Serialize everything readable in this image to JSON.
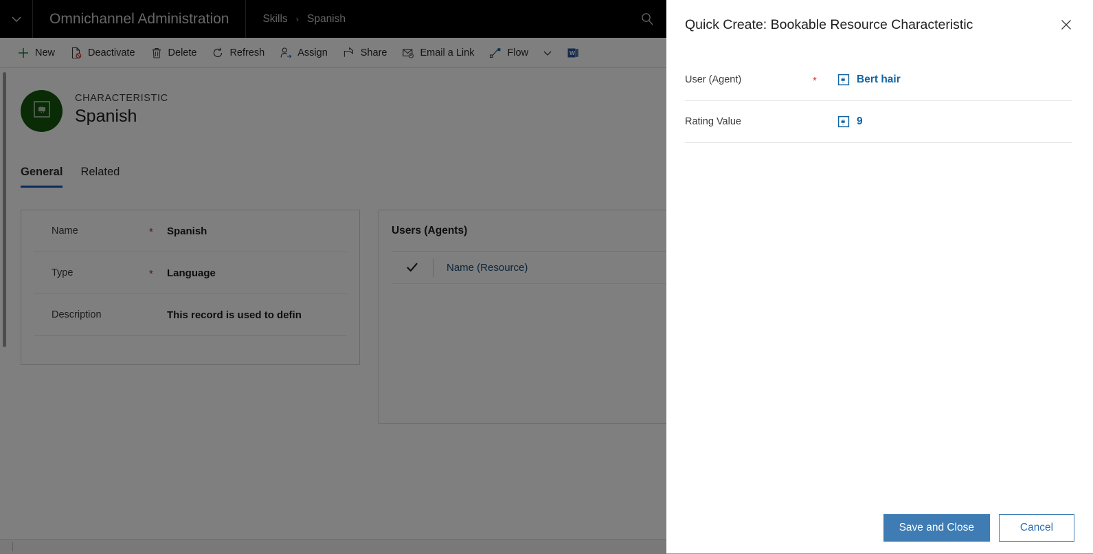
{
  "topbar": {
    "chevron_icon": "chevron-down-icon",
    "app_title": "Omnichannel Administration",
    "breadcrumb": {
      "parent": "Skills",
      "separator": "›",
      "current": "Spanish"
    },
    "search_icon": "search-icon"
  },
  "commandbar": {
    "items": [
      {
        "label": "New",
        "icon": "plus-icon"
      },
      {
        "label": "Deactivate",
        "icon": "deactivate-document-icon"
      },
      {
        "label": "Delete",
        "icon": "trash-icon"
      },
      {
        "label": "Refresh",
        "icon": "refresh-icon"
      },
      {
        "label": "Assign",
        "icon": "assign-user-icon"
      },
      {
        "label": "Share",
        "icon": "share-icon"
      },
      {
        "label": "Email a Link",
        "icon": "email-link-icon"
      },
      {
        "label": "Flow",
        "icon": "flow-icon"
      }
    ],
    "overflow_icon": "chevron-down-icon",
    "word_template_icon": "word-document-icon"
  },
  "record_header": {
    "entity_type": "CHARACTERISTIC",
    "record_name": "Spanish",
    "avatar_icon": "characteristic-puzzle-icon",
    "avatar_color": "#13570d"
  },
  "tabs": [
    {
      "label": "General",
      "active": true
    },
    {
      "label": "Related",
      "active": false
    }
  ],
  "form": {
    "fields": [
      {
        "label": "Name",
        "required": true,
        "value": "Spanish"
      },
      {
        "label": "Type",
        "required": true,
        "value": "Language"
      },
      {
        "label": "Description",
        "required": false,
        "value": "This record is used to defin"
      }
    ]
  },
  "subgrid": {
    "title": "Users (Agents)",
    "select_all_icon": "checkmark-icon",
    "columns": [
      "Name (Resource)"
    ],
    "rows": []
  },
  "quick_create": {
    "title": "Quick Create: Bookable Resource Characteristic",
    "close_icon": "close-icon",
    "fields": [
      {
        "label": "User (Agent)",
        "required": true,
        "value": "Bert hair",
        "icon": "lookup-record-icon"
      },
      {
        "label": "Rating Value",
        "required": false,
        "value": "9",
        "icon": "lookup-record-icon"
      }
    ],
    "primary_button": "Save and Close",
    "secondary_button": "Cancel",
    "accent_color": "#3f7cb4",
    "link_color": "#1264a3"
  }
}
